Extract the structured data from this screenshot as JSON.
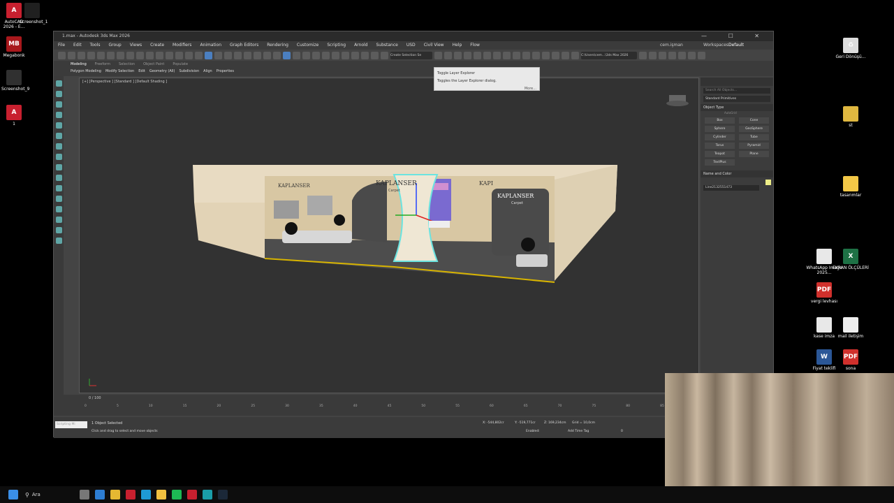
{
  "desktop_left": [
    {
      "label": "AutoCAD 2026 - E...",
      "icon": "A",
      "color": "#c8202f"
    },
    {
      "label": "Screenshot_1",
      "icon": "",
      "color": "#202020"
    },
    {
      "label": "Megabonk",
      "icon": "MB",
      "color": "#a8181c"
    },
    {
      "label": "Screenshot_9",
      "icon": "",
      "color": "#303030"
    },
    {
      "label": "1",
      "icon": "A",
      "color": "#c8202f"
    }
  ],
  "desktop_right": [
    {
      "label": "Geri Dönüşü...",
      "icon": "♻",
      "color": "#dddddd"
    },
    {
      "label": "st",
      "icon": "",
      "color": "#e0b840"
    },
    {
      "label": "tasarımlar",
      "icon": "",
      "color": "#f3c847"
    },
    {
      "label": "WhatsApp Image 2025...",
      "icon": "",
      "color": "#e8e8e8"
    },
    {
      "label": "EKRAN ÖLÇÜLERİ",
      "icon": "X",
      "color": "#1e7145"
    },
    {
      "label": "vergi levhası",
      "icon": "PDF",
      "color": "#d0302c"
    },
    {
      "label": "kase imza",
      "icon": "",
      "color": "#e8e8e8"
    },
    {
      "label": "mail iletişim",
      "icon": "",
      "color": "#eeeeee"
    },
    {
      "label": "Fiyat teklifi",
      "icon": "W",
      "color": "#2b5797"
    },
    {
      "label": "sona",
      "icon": "PDF",
      "color": "#d0302c"
    }
  ],
  "window": {
    "title": "1.max - Autodesk 3ds Max 2026",
    "menus": [
      "File",
      "Edit",
      "Tools",
      "Group",
      "Views",
      "Create",
      "Modifiers",
      "Animation",
      "Graph Editors",
      "Rendering",
      "Customize",
      "Scripting",
      "Arnold",
      "Substance",
      "USD",
      "Civil View",
      "Help",
      "Flow"
    ],
    "user": "cem.işman",
    "workspace_label": "Workspaces:",
    "workspace_value": "Default",
    "selection_set": "Create Selection Se",
    "path": "C:\\Users\\cem...\\3ds Max 2026"
  },
  "ribbon": {
    "tabs": [
      "Modeling",
      "Freeform",
      "Selection",
      "Object Paint",
      "Populate"
    ],
    "items": [
      "Polygon Modeling",
      "Modify Selection",
      "Edit",
      "Geometry (All)",
      "Subdivision",
      "Align",
      "Properties"
    ]
  },
  "tooltip": {
    "title": "Toggle Layer Explorer",
    "desc": "Toggles the Layer Explorer dialog.",
    "more": "More..."
  },
  "viewport": {
    "label": "[+] [Perspective ] [Standard ] [Default Shading ]",
    "brand_main": "KAPLANSER",
    "brand_sub": "Carpet",
    "brand_partial": "KAPI"
  },
  "command_panel": {
    "search_placeholder": "Search All Objects...",
    "category": "Standard Primitives",
    "object_type_header": "Object Type",
    "autogrid": "AutoGrid",
    "primitives": [
      "Box",
      "Cone",
      "Sphere",
      "GeoSphere",
      "Cylinder",
      "Tube",
      "Torus",
      "Pyramid",
      "Teapot",
      "Plane",
      "TextPlus"
    ],
    "name_color_header": "Name and Color",
    "object_name": "Line2132551473",
    "color": "#eeee88"
  },
  "timeline": {
    "frame": "0 / 100",
    "ticks": [
      "0",
      "5",
      "10",
      "15",
      "20",
      "25",
      "30",
      "35",
      "40",
      "45",
      "50",
      "55",
      "60",
      "65",
      "70",
      "75",
      "80",
      "85"
    ]
  },
  "status": {
    "script_listener": "Scripting Mi",
    "selected": "1 Object Selected",
    "prompt": "Click and drag to select and move objects",
    "x": "X: -544,802cr",
    "y": "Y: -519,771cr",
    "z": "Z: 169,234cm",
    "grid": "Grid = 10,0cm",
    "enabled": "Enabled:",
    "add_time_tag": "Add Time Tag",
    "frame_value": "0"
  },
  "taskbar": {
    "search": "Ara"
  }
}
